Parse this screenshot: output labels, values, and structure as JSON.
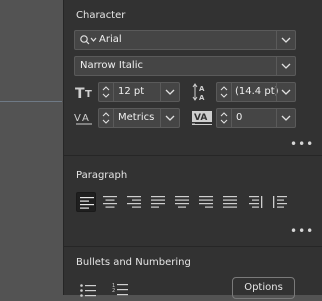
{
  "character": {
    "title": "Character",
    "font_family": "Arial",
    "font_style": "Narrow Italic",
    "font_size": "12 pt",
    "leading": "(14.4 pt)",
    "kerning": "Metrics",
    "tracking": "0",
    "more": "•••"
  },
  "paragraph": {
    "title": "Paragraph",
    "more": "•••"
  },
  "bullets": {
    "title": "Bullets and Numbering",
    "options_label": "Options"
  },
  "colors": {
    "panel": "#323232",
    "field": "#454545",
    "background": "#535353"
  }
}
